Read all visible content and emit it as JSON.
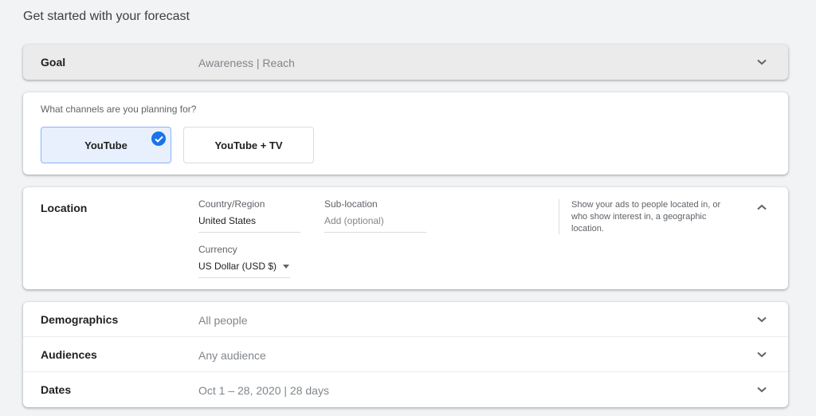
{
  "page": {
    "title": "Get started with your forecast"
  },
  "goal": {
    "label": "Goal",
    "value": "Awareness | Reach"
  },
  "channels": {
    "question": "What channels are you planning for?",
    "options": [
      {
        "label": "YouTube",
        "selected": true
      },
      {
        "label": "YouTube + TV",
        "selected": false
      }
    ]
  },
  "location": {
    "label": "Location",
    "country_caption": "Country/Region",
    "country_value": "United States",
    "sublocation_caption": "Sub-location",
    "sublocation_placeholder": "Add (optional)",
    "currency_caption": "Currency",
    "currency_value": "US Dollar (USD $)",
    "help": "Show your ads to people located in, or who show interest in, a geographic location."
  },
  "demographics": {
    "label": "Demographics",
    "value": "All people"
  },
  "audiences": {
    "label": "Audiences",
    "value": "Any audience"
  },
  "dates": {
    "label": "Dates",
    "value": "Oct 1 – 28, 2020 | 28 days"
  },
  "colors": {
    "accent": "#1a73e8",
    "background": "#f1f3f4"
  }
}
